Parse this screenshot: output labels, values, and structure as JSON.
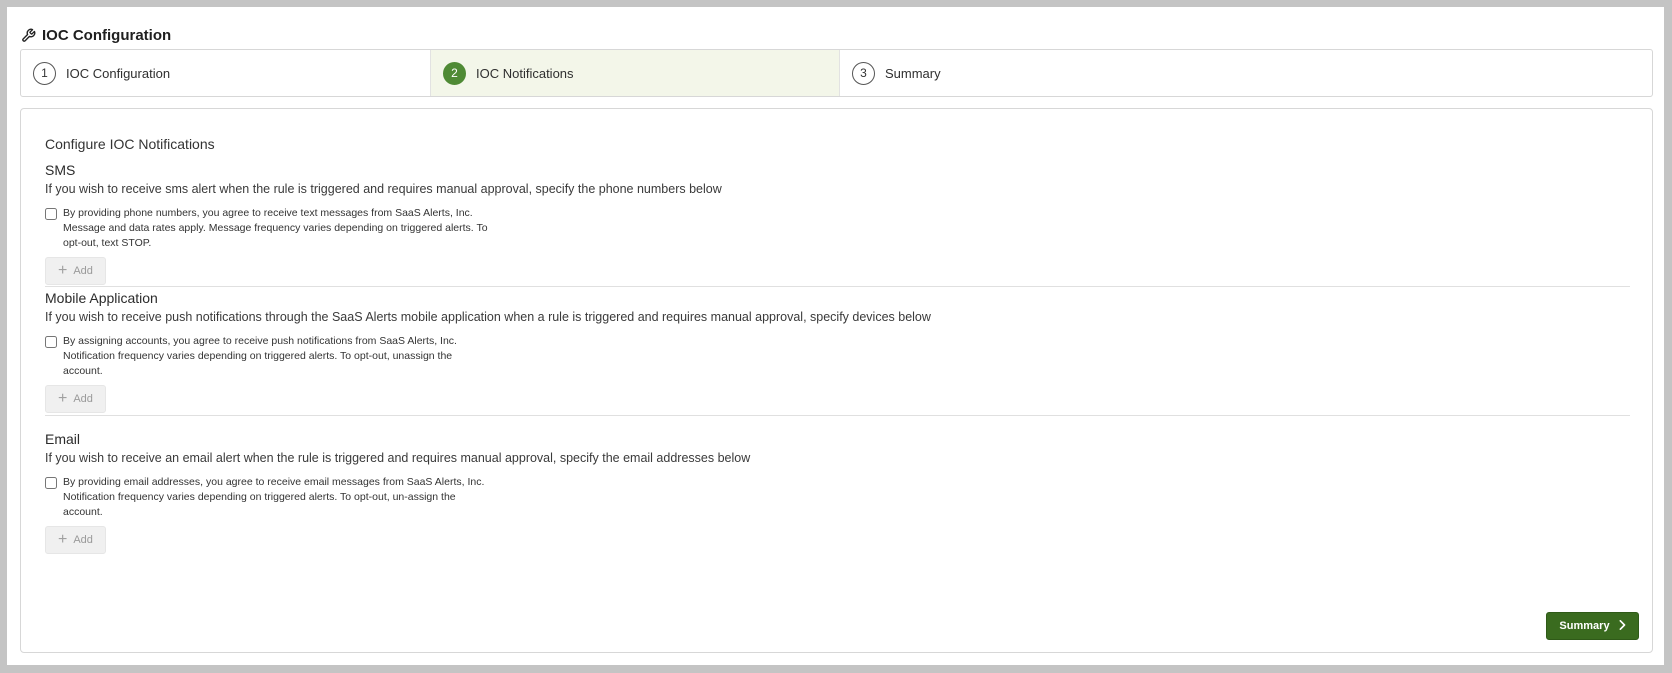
{
  "header": {
    "title": "IOC Configuration",
    "icon": "wrench-icon"
  },
  "steps": [
    {
      "number": "1",
      "label": "IOC Configuration",
      "active": false
    },
    {
      "number": "2",
      "label": "IOC Notifications",
      "active": true
    },
    {
      "number": "3",
      "label": "Summary",
      "active": false
    }
  ],
  "main": {
    "heading": "Configure IOC Notifications",
    "sms": {
      "title": "SMS",
      "description": "If you wish to receive sms alert when the rule is triggered and requires manual approval, specify the phone numbers below",
      "consent_line1": "By providing phone numbers, you agree to receive text messages from SaaS Alerts, Inc.",
      "consent_line2": "Message and data rates apply. Message frequency varies depending on triggered alerts. To",
      "consent_line3": "opt-out, text STOP.",
      "checked": false,
      "add_label": "Add"
    },
    "mobile": {
      "title": "Mobile Application",
      "description": "If you wish to receive push notifications through the SaaS Alerts mobile application when a rule is triggered and requires manual approval, specify devices below",
      "consent_line1": "By assigning accounts, you agree to receive push notifications from SaaS Alerts, Inc.",
      "consent_line2": "Notification frequency varies depending on triggered alerts. To opt-out, unassign the",
      "consent_line3": "account.",
      "checked": false,
      "add_label": "Add"
    },
    "email": {
      "title": "Email",
      "description": "If you wish to receive an email alert when the rule is triggered and requires manual approval, specify the email addresses below",
      "consent_line1": "By providing email addresses, you agree to receive email messages from SaaS Alerts, Inc.",
      "consent_line2": "Notification frequency varies depending on triggered alerts. To opt-out, un-assign the",
      "consent_line3": "account.",
      "checked": false,
      "add_label": "Add"
    },
    "next_button_label": "Summary"
  },
  "colors": {
    "accent": "#4f8a35",
    "primary_button": "#3a6b1f",
    "active_step_bg": "#f3f6e9"
  }
}
